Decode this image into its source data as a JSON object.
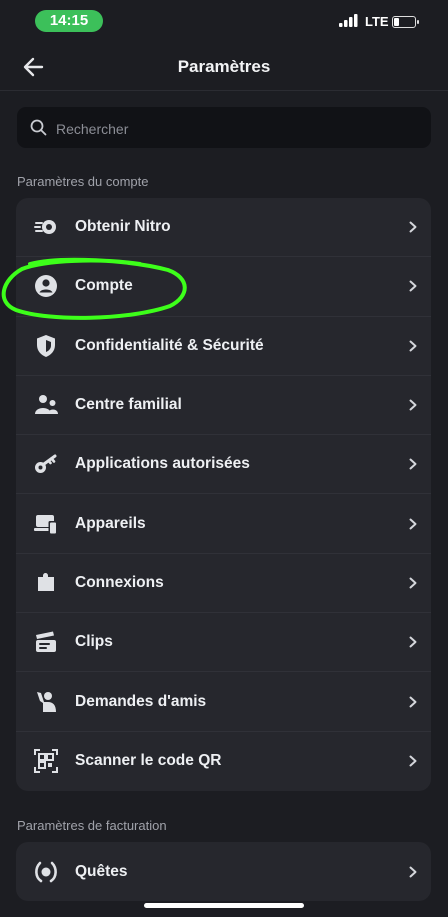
{
  "status_bar": {
    "time": "14:15",
    "carrier": "LTE"
  },
  "header": {
    "title": "Paramètres"
  },
  "search": {
    "placeholder": "Rechercher"
  },
  "sections": {
    "account": {
      "title": "Paramètres du compte",
      "items": [
        {
          "label": "Obtenir Nitro",
          "icon": "nitro-icon"
        },
        {
          "label": "Compte",
          "icon": "account-icon"
        },
        {
          "label": "Confidentialité & Sécurité",
          "icon": "shield-icon"
        },
        {
          "label": "Centre familial",
          "icon": "family-icon"
        },
        {
          "label": "Applications autorisées",
          "icon": "key-icon"
        },
        {
          "label": "Appareils",
          "icon": "devices-icon"
        },
        {
          "label": "Connexions",
          "icon": "puzzle-icon"
        },
        {
          "label": "Clips",
          "icon": "clapperboard-icon"
        },
        {
          "label": "Demandes d'amis",
          "icon": "waving-person-icon"
        },
        {
          "label": "Scanner le code QR",
          "icon": "qr-code-icon"
        }
      ]
    },
    "billing": {
      "title": "Paramètres de facturation",
      "items": [
        {
          "label": "Quêtes",
          "icon": "laurel-icon"
        }
      ]
    }
  },
  "colors": {
    "background": "#1c1d22",
    "card": "#26272d",
    "annotation": "#3dff1a",
    "time_pill": "#3cc05a"
  }
}
